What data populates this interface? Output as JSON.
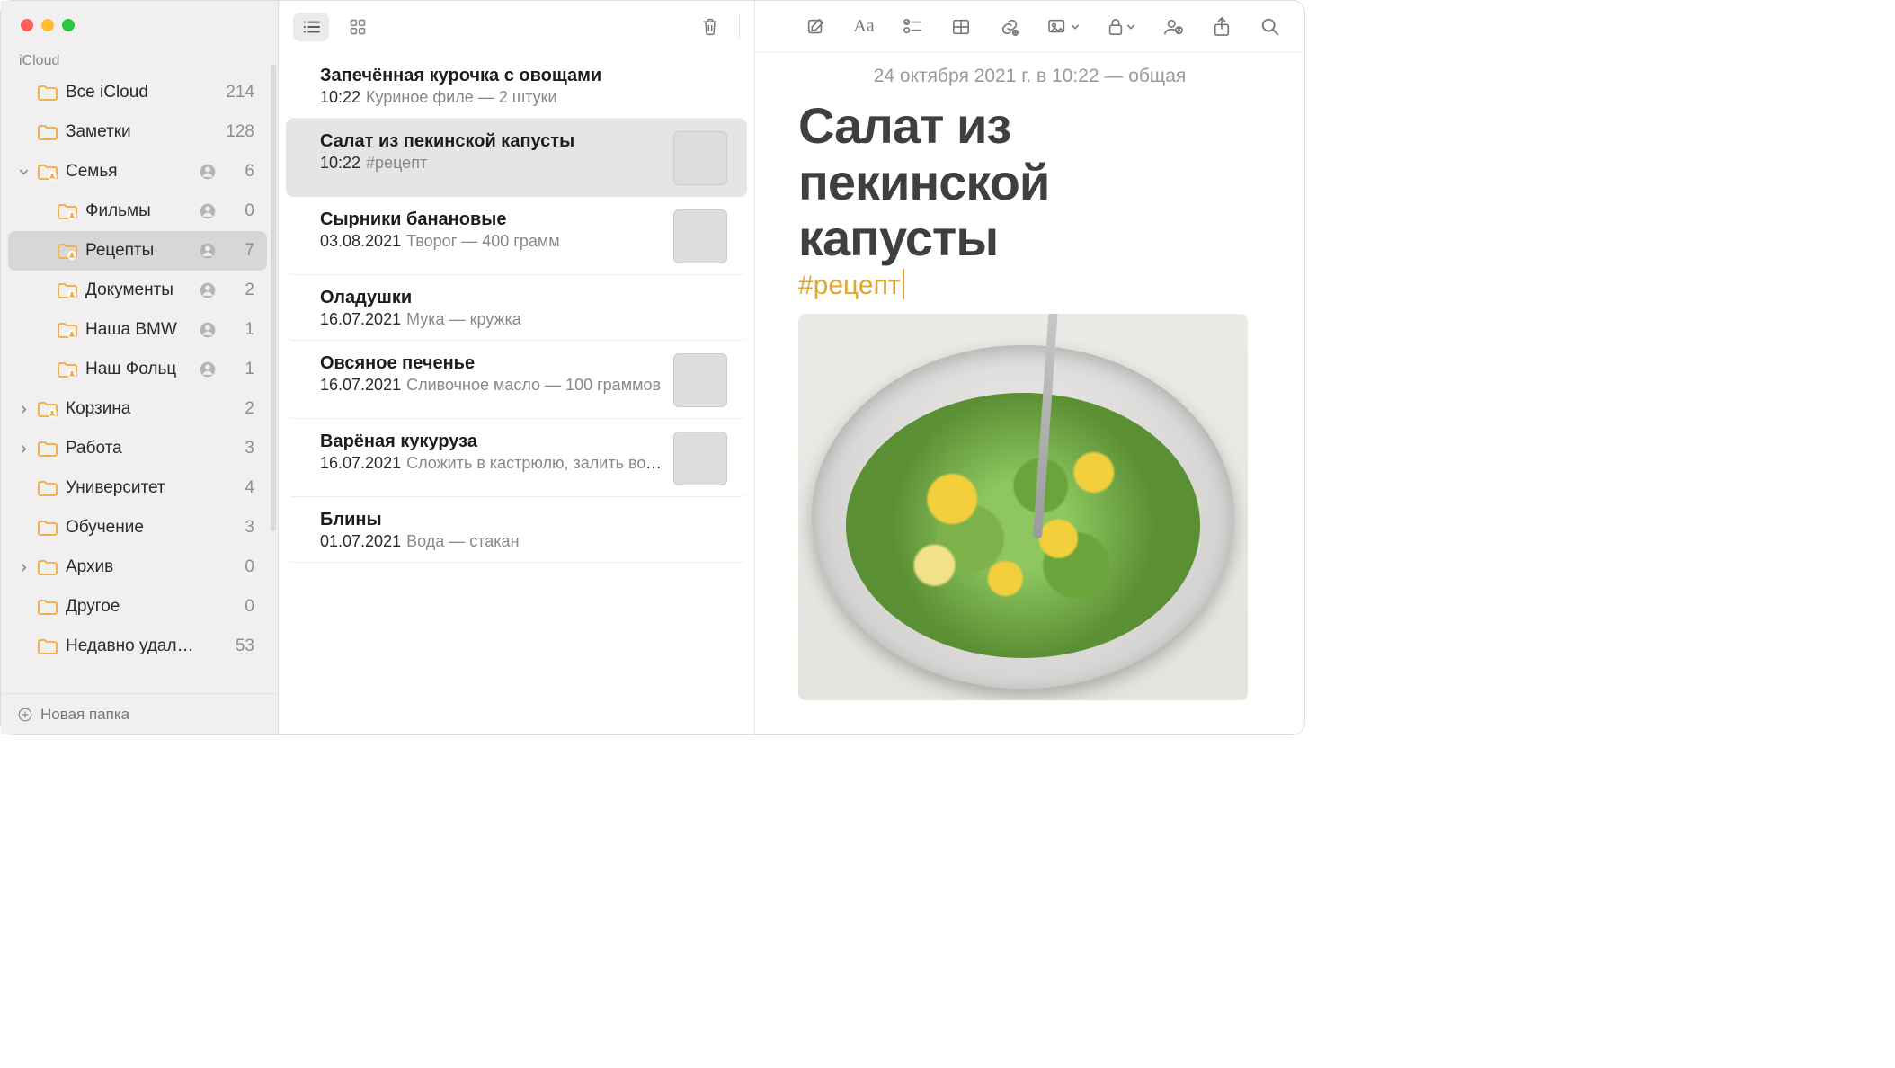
{
  "sidebar": {
    "section_label": "iCloud",
    "new_folder_label": "Новая папка",
    "folders": [
      {
        "label": "Все iCloud",
        "count": "214",
        "shared": false,
        "indent": 1,
        "chevron": "",
        "selected": false,
        "special": "plain"
      },
      {
        "label": "Заметки",
        "count": "128",
        "shared": false,
        "indent": 1,
        "chevron": "",
        "selected": false,
        "special": "plain"
      },
      {
        "label": "Семья",
        "count": "6",
        "shared": true,
        "indent": 1,
        "chevron": "down",
        "selected": false,
        "special": "shared"
      },
      {
        "label": "Фильмы",
        "count": "0",
        "shared": true,
        "indent": 2,
        "chevron": "",
        "selected": false,
        "special": "shared"
      },
      {
        "label": "Рецепты",
        "count": "7",
        "shared": true,
        "indent": 2,
        "chevron": "",
        "selected": true,
        "special": "shared"
      },
      {
        "label": "Документы",
        "count": "2",
        "shared": true,
        "indent": 2,
        "chevron": "",
        "selected": false,
        "special": "shared"
      },
      {
        "label": "Наша BMW",
        "count": "1",
        "shared": true,
        "indent": 2,
        "chevron": "",
        "selected": false,
        "special": "shared"
      },
      {
        "label": "Наш Фольц",
        "count": "1",
        "shared": true,
        "indent": 2,
        "chevron": "",
        "selected": false,
        "special": "shared"
      },
      {
        "label": "Корзина",
        "count": "2",
        "shared": false,
        "indent": 1,
        "chevron": "right",
        "selected": false,
        "special": "shared"
      },
      {
        "label": "Работа",
        "count": "3",
        "shared": false,
        "indent": 1,
        "chevron": "right",
        "selected": false,
        "special": "plain"
      },
      {
        "label": "Университет",
        "count": "4",
        "shared": false,
        "indent": 1,
        "chevron": "",
        "selected": false,
        "special": "plain"
      },
      {
        "label": "Обучение",
        "count": "3",
        "shared": false,
        "indent": 1,
        "chevron": "",
        "selected": false,
        "special": "plain"
      },
      {
        "label": "Архив",
        "count": "0",
        "shared": false,
        "indent": 1,
        "chevron": "right",
        "selected": false,
        "special": "plain"
      },
      {
        "label": "Другое",
        "count": "0",
        "shared": false,
        "indent": 1,
        "chevron": "",
        "selected": false,
        "special": "plain"
      },
      {
        "label": "Недавно удал…",
        "count": "53",
        "shared": false,
        "indent": 1,
        "chevron": "",
        "selected": false,
        "special": "plain"
      }
    ]
  },
  "list_toolbar": {
    "view_list_active": true
  },
  "notes": [
    {
      "title": "Запечённая курочка с овощами",
      "date": "10:22",
      "snippet": "Куриное филе — 2 штуки",
      "thumb": "",
      "selected": false
    },
    {
      "title": "Салат из пекинской капусты",
      "date": "10:22",
      "snippet": "#рецепт",
      "thumb": "salad",
      "selected": true
    },
    {
      "title": "Сырники банановые",
      "date": "03.08.2021",
      "snippet": "Творог — 400 грамм",
      "thumb": "syrn",
      "selected": false
    },
    {
      "title": "Оладушки",
      "date": "16.07.2021",
      "snippet": "Мука — кружка",
      "thumb": "",
      "selected": false
    },
    {
      "title": "Овсяное печенье",
      "date": "16.07.2021",
      "snippet": "Сливочное масло — 100 граммов",
      "thumb": "cook",
      "selected": false
    },
    {
      "title": "Варёная кукуруза",
      "date": "16.07.2021",
      "snippet": "Сложить в кастрюлю, залить вод…",
      "thumb": "corn",
      "selected": false
    },
    {
      "title": "Блины",
      "date": "01.07.2021",
      "snippet": "Вода — стакан",
      "thumb": "",
      "selected": false
    }
  ],
  "editor": {
    "timestamp": "24 октября 2021 г. в 10:22 — общая",
    "title": "Салат из пекинской капусты",
    "tag": "#рецепт"
  },
  "colors": {
    "folder_accent": "#f3a93a",
    "tag": "#e2a531"
  }
}
